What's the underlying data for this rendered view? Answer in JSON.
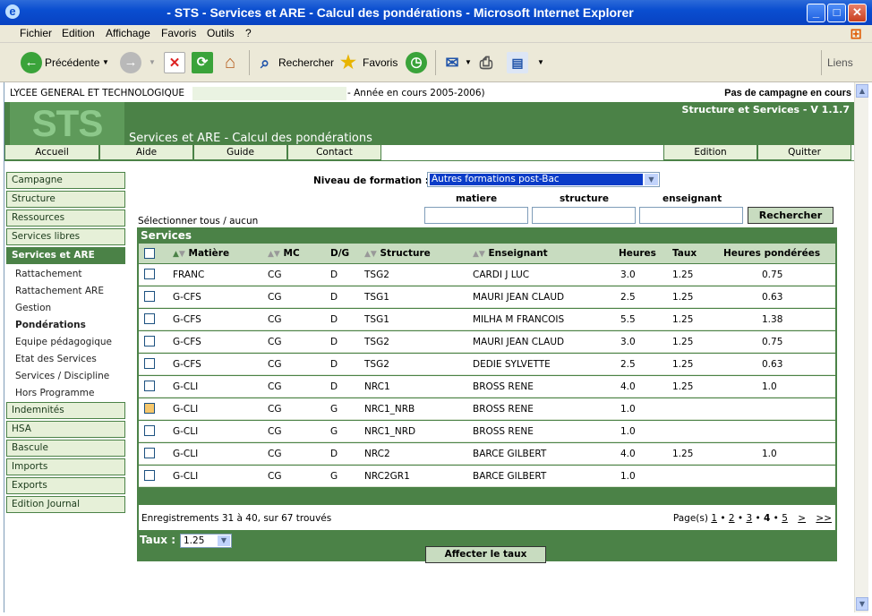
{
  "window": {
    "title": "- STS - Services et ARE - Calcul des pondérations - Microsoft Internet Explorer"
  },
  "menu": [
    "Fichier",
    "Edition",
    "Affichage",
    "Favoris",
    "Outils",
    "?"
  ],
  "toolbar": {
    "back": "Précédente",
    "search": "Rechercher",
    "favorites": "Favoris",
    "links": "Liens"
  },
  "header": {
    "school": "LYCEE GENERAL ET TECHNOLOGIQUE",
    "year": "- Année en cours 2005-2006)",
    "campaign": "Pas de campagne en cours",
    "logo": "STS",
    "version": "Structure et Services - V 1.1.7",
    "app_title": "Services et ARE - Calcul des pondérations"
  },
  "nav": {
    "left": [
      "Accueil",
      "Aide",
      "Guide",
      "Contact"
    ],
    "right": [
      "Edition",
      "Quitter"
    ]
  },
  "sidebar": {
    "sections_top": [
      "Campagne",
      "Structure",
      "Ressources",
      "Services libres",
      "Services et ARE"
    ],
    "sublinks": [
      "Rattachement",
      "Rattachement ARE",
      "Gestion",
      "Pondérations",
      "Equipe pédagogique",
      "Etat des Services",
      "Services / Discipline",
      "Hors Programme"
    ],
    "sections_bottom": [
      "Indemnités",
      "HSA",
      "Bascule",
      "Imports",
      "Exports",
      "Edition Journal"
    ]
  },
  "search": {
    "niveau_label": "Niveau de formation :",
    "niveau_value": "Autres formations post-Bac",
    "matiere": "matiere",
    "structure": "structure",
    "enseignant": "enseignant",
    "button": "Rechercher",
    "select_prefix": "Sélectionner",
    "select_all": "tous",
    "select_sep": "/",
    "select_none": "aucun"
  },
  "table": {
    "title": "Services",
    "headers": {
      "matiere": "Matière",
      "mc": "MC",
      "dg": "D/G",
      "structure": "Structure",
      "enseignant": "Enseignant",
      "heures": "Heures",
      "taux": "Taux",
      "hp": "Heures pondérées"
    },
    "rows": [
      {
        "matiere": "FRANC",
        "mc": "CG",
        "dg": "D",
        "structure": "TSG2",
        "enseignant": "CARDI J LUC",
        "heures": "3.0",
        "taux": "1.25",
        "hp": "0.75"
      },
      {
        "matiere": "G-CFS",
        "mc": "CG",
        "dg": "D",
        "structure": "TSG1",
        "enseignant": "MAURI JEAN CLAUD",
        "heures": "2.5",
        "taux": "1.25",
        "hp": "0.63"
      },
      {
        "matiere": "G-CFS",
        "mc": "CG",
        "dg": "D",
        "structure": "TSG1",
        "enseignant": "MILHA M FRANCOIS",
        "heures": "5.5",
        "taux": "1.25",
        "hp": "1.38"
      },
      {
        "matiere": "G-CFS",
        "mc": "CG",
        "dg": "D",
        "structure": "TSG2",
        "enseignant": "MAURI JEAN CLAUD",
        "heures": "3.0",
        "taux": "1.25",
        "hp": "0.75"
      },
      {
        "matiere": "G-CFS",
        "mc": "CG",
        "dg": "D",
        "structure": "TSG2",
        "enseignant": "DEDIE SYLVETTE",
        "heures": "2.5",
        "taux": "1.25",
        "hp": "0.63"
      },
      {
        "matiere": "G-CLI",
        "mc": "CG",
        "dg": "D",
        "structure": "NRC1",
        "enseignant": "BROSS RENE",
        "heures": "4.0",
        "taux": "1.25",
        "hp": "1.0"
      },
      {
        "matiere": "G-CLI",
        "mc": "CG",
        "dg": "G",
        "structure": "NRC1_NRB",
        "enseignant": "BROSS RENE",
        "heures": "1.0",
        "taux": "",
        "hp": ""
      },
      {
        "matiere": "G-CLI",
        "mc": "CG",
        "dg": "G",
        "structure": "NRC1_NRD",
        "enseignant": "BROSS RENE",
        "heures": "1.0",
        "taux": "",
        "hp": ""
      },
      {
        "matiere": "G-CLI",
        "mc": "CG",
        "dg": "D",
        "structure": "NRC2",
        "enseignant": "BARCE GILBERT",
        "heures": "4.0",
        "taux": "1.25",
        "hp": "1.0"
      },
      {
        "matiere": "G-CLI",
        "mc": "CG",
        "dg": "G",
        "structure": "NRC2GR1",
        "enseignant": "BARCE GILBERT",
        "heures": "1.0",
        "taux": "",
        "hp": ""
      }
    ],
    "records": "Enregistrements 31 à 40, sur 67 trouvés",
    "pages_label": "Page(s)",
    "pages": [
      "1",
      "2",
      "3",
      "4",
      "5"
    ],
    "current_page": "4",
    "next": ">",
    "last": ">>"
  },
  "taux": {
    "label": "Taux :",
    "value": "1.25",
    "button": "Affecter le taux"
  }
}
